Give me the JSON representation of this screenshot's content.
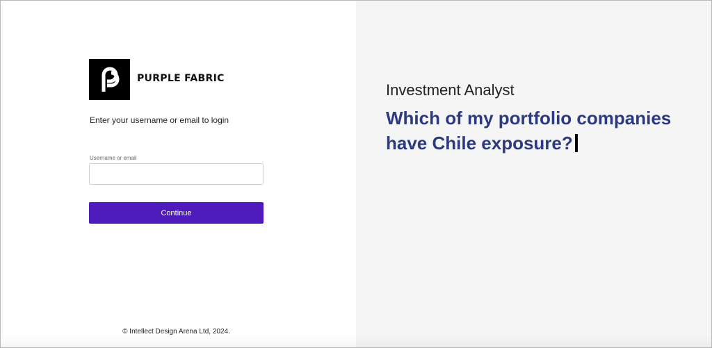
{
  "brand": {
    "name": "PURPLE FABRIC",
    "logo_icon": "purple-fabric-logo"
  },
  "login": {
    "prompt": "Enter your username or email to login",
    "username_label": "Username or email",
    "username_value": "",
    "continue_label": "Continue"
  },
  "footer": {
    "copyright": "© Intellect Design Arena Ltd, 2024."
  },
  "showcase": {
    "role": "Investment Analyst",
    "question": "Which of my portfolio companies have Chile exposure?"
  },
  "colors": {
    "accent": "#4f1bbd",
    "headline": "#2c3a80",
    "right_pane_bg": "#f5f5f5"
  }
}
